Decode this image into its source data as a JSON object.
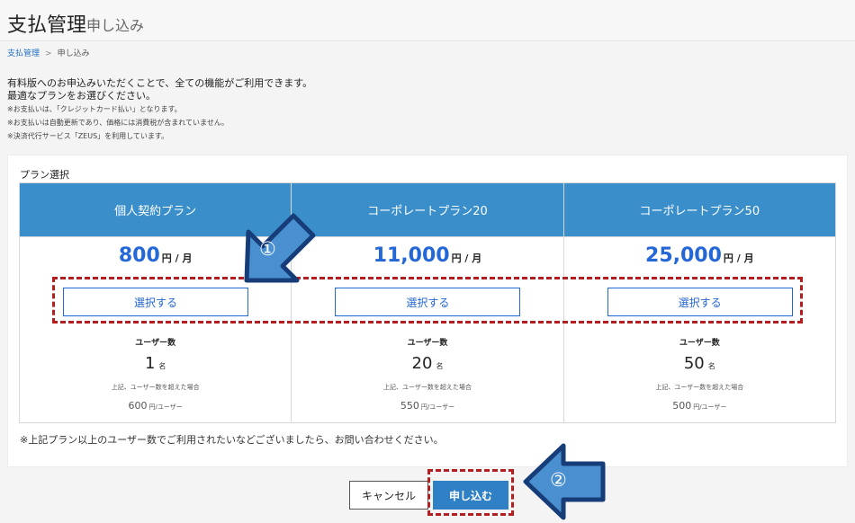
{
  "header": {
    "title": "支払管理",
    "subtitle": "申し込み"
  },
  "breadcrumb": {
    "root": "支払管理",
    "separator": ">",
    "current": "申し込み"
  },
  "intro": {
    "line1": "有料版へのお申込みいただくことで、全ての機能がご利用できます。",
    "line2": "最適なプランをお選びください。",
    "notes": [
      "※お支払いは、「クレジットカード払い」となります。",
      "※お支払いは自動更新であり、価格には消費税が含まれていません。",
      "※決済代行サービス「ZEUS」を利用しています。"
    ]
  },
  "plan_section": {
    "title": "プラン選択",
    "select_label": "選択する",
    "price_unit": "円 / 月",
    "users_label": "ユーザー数",
    "users_unit": "名",
    "over_note": "上記、ユーザー数を超えた場合",
    "over_unit": "円/ユーザー",
    "plans": [
      {
        "name": "個人契約プラン",
        "price": "800",
        "users": "1",
        "over_price": "600"
      },
      {
        "name": "コーポレートプラン20",
        "price": "11,000",
        "users": "20",
        "over_price": "550"
      },
      {
        "name": "コーポレートプラン50",
        "price": "25,000",
        "users": "50",
        "over_price": "500"
      }
    ],
    "footnote": "※上記プラン以上のユーザー数でご利用されたいなどございましたら、お問い合わせください。"
  },
  "actions": {
    "cancel_label": "キャンセル",
    "submit_label": "申し込む"
  },
  "annotations": {
    "step1": "①",
    "step2": "②",
    "arrow_color": "#4a90d0",
    "highlight_color": "#b51e1e"
  },
  "colors": {
    "accent": "#2467d6",
    "plan_header": "#3a8fcb",
    "submit": "#2f80c5"
  }
}
